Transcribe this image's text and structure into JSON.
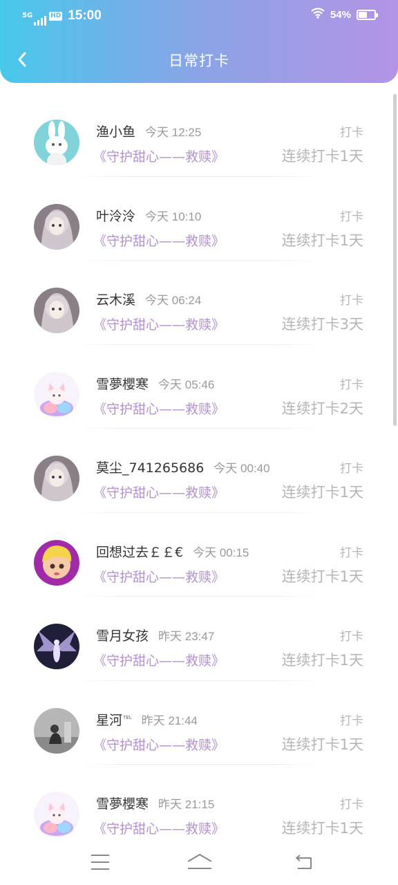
{
  "status_bar": {
    "network": "5G",
    "hd": "HD",
    "time": "15:00",
    "battery": "54%",
    "battery_level": 0.54
  },
  "header": {
    "title": "日常打卡",
    "gradient": [
      "#47c8ea",
      "#b493e6"
    ]
  },
  "colors": {
    "book": "#b48fd6",
    "muted": "#b5b5b5",
    "name": "#333333"
  },
  "checkins": [
    {
      "name": "渔小鱼",
      "time": "今天 12:25",
      "book": "《守护甜心——救赎》",
      "action": "打卡",
      "streak": "连续打卡1天",
      "avatar": "bunny-avatar"
    },
    {
      "name": "叶泠泠",
      "time": "今天 10:10",
      "book": "《守护甜心——救赎》",
      "action": "打卡",
      "streak": "连续打卡1天",
      "avatar": "anime-avatar"
    },
    {
      "name": "云木溪",
      "time": "今天 06:24",
      "book": "《守护甜心——救赎》",
      "action": "打卡",
      "streak": "连续打卡3天",
      "avatar": "anime-avatar"
    },
    {
      "name": "雪夢櫻寒",
      "time": "今天 05:46",
      "book": "《守护甜心——救赎》",
      "action": "打卡",
      "streak": "连续打卡2天",
      "avatar": "cat-avatar"
    },
    {
      "name": "莫尘_741265686",
      "time": "今天 00:40",
      "book": "《守护甜心——救赎》",
      "action": "打卡",
      "streak": "连续打卡1天",
      "avatar": "anime-avatar"
    },
    {
      "name": "回想过去￡￡€",
      "time": "今天 00:15",
      "book": "《守护甜心——救赎》",
      "action": "打卡",
      "streak": "连续打卡1天",
      "avatar": "doll-avatar"
    },
    {
      "name": "雪月女孩",
      "time": "昨天 23:47",
      "book": "《守护甜心——救赎》",
      "action": "打卡",
      "streak": "连续打卡1天",
      "avatar": "wings-avatar"
    },
    {
      "name": "星河",
      "name_sup": "TEL",
      "time": "昨天 21:44",
      "book": "《守护甜心——救赎》",
      "action": "打卡",
      "streak": "连续打卡1天",
      "avatar": "photo-avatar"
    },
    {
      "name": "雪夢櫻寒",
      "time": "昨天 21:15",
      "book": "《守护甜心——救赎》",
      "action": "打卡",
      "streak": "连续打卡1天",
      "avatar": "cat-avatar"
    }
  ],
  "nav_bar": {
    "icons": [
      "menu-icon",
      "home-icon",
      "back-icon"
    ]
  }
}
